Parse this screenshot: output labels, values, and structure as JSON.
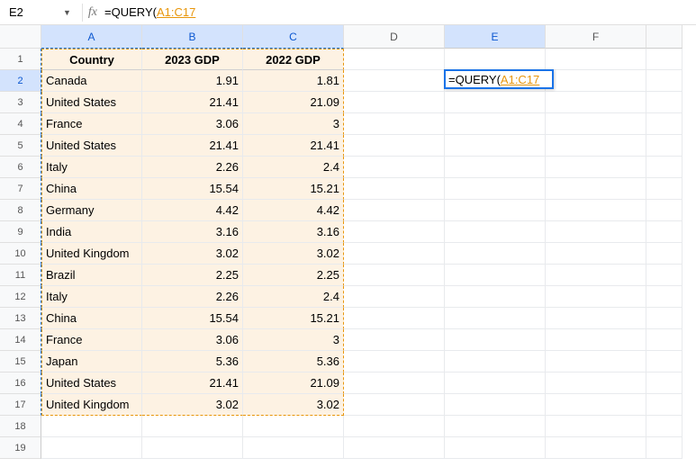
{
  "formula_bar": {
    "cell_ref": "E2",
    "fx_label": "fx",
    "formula_prefix": "=QUERY(",
    "formula_range": "A1:C17"
  },
  "columns": [
    "A",
    "B",
    "C",
    "D",
    "E",
    "F"
  ],
  "headers": {
    "A": "Country",
    "B": "2023 GDP",
    "C": "2022 GDP"
  },
  "rows": [
    {
      "n": "1"
    },
    {
      "n": "2",
      "A": "Canada",
      "B": "1.91",
      "C": "1.81"
    },
    {
      "n": "3",
      "A": "United States",
      "B": "21.41",
      "C": "21.09"
    },
    {
      "n": "4",
      "A": "France",
      "B": "3.06",
      "C": "3"
    },
    {
      "n": "5",
      "A": "United States",
      "B": "21.41",
      "C": "21.41"
    },
    {
      "n": "6",
      "A": "Italy",
      "B": "2.26",
      "C": "2.4"
    },
    {
      "n": "7",
      "A": "China",
      "B": "15.54",
      "C": "15.21"
    },
    {
      "n": "8",
      "A": "Germany",
      "B": "4.42",
      "C": "4.42"
    },
    {
      "n": "9",
      "A": "India",
      "B": "3.16",
      "C": "3.16"
    },
    {
      "n": "10",
      "A": "United Kingdom",
      "B": "3.02",
      "C": "3.02"
    },
    {
      "n": "11",
      "A": "Brazil",
      "B": "2.25",
      "C": "2.25"
    },
    {
      "n": "12",
      "A": "Italy",
      "B": "2.26",
      "C": "2.4"
    },
    {
      "n": "13",
      "A": "China",
      "B": "15.54",
      "C": "15.21"
    },
    {
      "n": "14",
      "A": "France",
      "B": "3.06",
      "C": "3"
    },
    {
      "n": "15",
      "A": "Japan",
      "B": "5.36",
      "C": "5.36"
    },
    {
      "n": "16",
      "A": "United States",
      "B": "21.41",
      "C": "21.09"
    },
    {
      "n": "17",
      "A": "United Kingdom",
      "B": "3.02",
      "C": "3.02"
    },
    {
      "n": "18"
    },
    {
      "n": "19"
    }
  ],
  "editing_cell": {
    "prefix": "=QUERY(",
    "range": "A1:C17"
  }
}
